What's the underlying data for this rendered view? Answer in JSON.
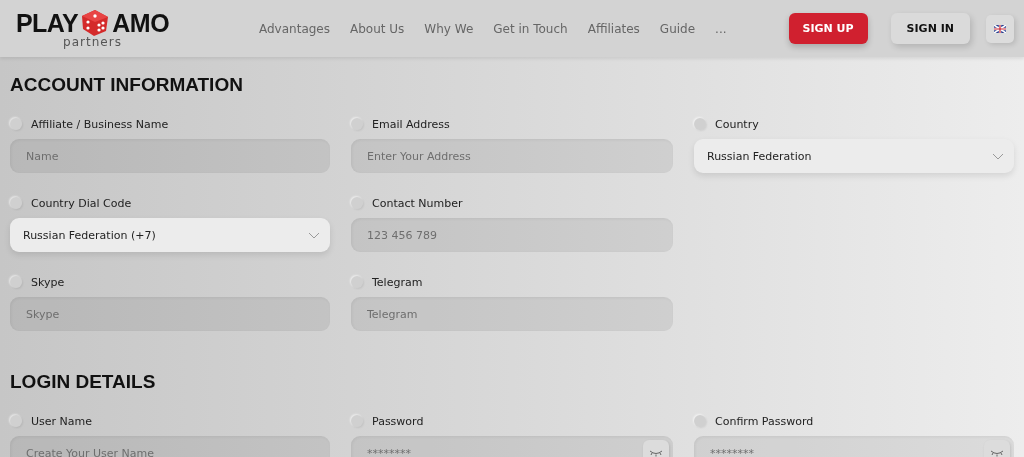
{
  "logo": {
    "left": "PLAY",
    "right": "AMO",
    "tagline": "partners"
  },
  "nav": [
    "Advantages",
    "About Us",
    "Why We",
    "Get in Touch",
    "Affiliates",
    "Guide",
    "..."
  ],
  "buttons": {
    "sign_up": "SIGN UP",
    "sign_in": "SIGN IN"
  },
  "sections": [
    {
      "title": "ACCOUNT INFORMATION",
      "rows": [
        [
          {
            "label": "Affiliate / Business Name",
            "kind": "input",
            "placeholder": "Name"
          },
          {
            "label": "Email Address",
            "kind": "input",
            "placeholder": "Enter Your Address"
          },
          {
            "label": "Country",
            "kind": "select",
            "value": "Russian Federation"
          }
        ],
        [
          {
            "label": "Country Dial Code",
            "kind": "select",
            "value": "Russian Federation (+7)"
          },
          {
            "label": "Contact Number",
            "kind": "input",
            "placeholder": "123 456 789"
          }
        ],
        [
          {
            "label": "Skype",
            "kind": "input",
            "placeholder": "Skype"
          },
          {
            "label": "Telegram",
            "kind": "input",
            "placeholder": "Telegram"
          }
        ]
      ]
    },
    {
      "title": "LOGIN DETAILS",
      "rows": [
        [
          {
            "label": "User Name",
            "kind": "input",
            "placeholder": "Create Your User Name"
          },
          {
            "label": "Password",
            "kind": "password",
            "placeholder": "********"
          },
          {
            "label": "Confirm Password",
            "kind": "password",
            "placeholder": "********"
          }
        ]
      ]
    }
  ]
}
